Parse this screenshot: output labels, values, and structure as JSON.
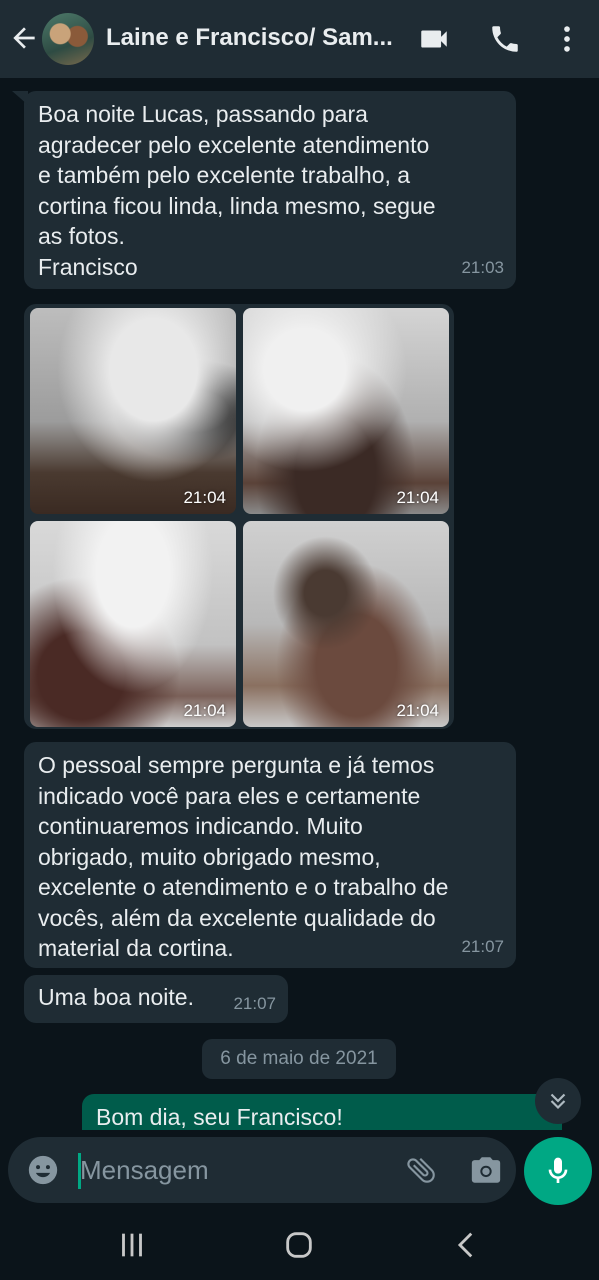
{
  "header": {
    "title": "Laine e Francisco/ Sam...",
    "icons": [
      "back-arrow-icon",
      "avatar",
      "video-call-icon",
      "voice-call-icon",
      "more-options-icon"
    ]
  },
  "messages": [
    {
      "direction": "incoming",
      "text": "Boa noite Lucas, passando para\nagradecer pelo excelente atendimento\ne também pelo excelente trabalho, a\ncortina ficou linda, linda mesmo, segue\nas fotos.\nFrancisco",
      "time": "21:03"
    },
    {
      "direction": "incoming",
      "type": "photos",
      "photos": [
        {
          "time": "21:04"
        },
        {
          "time": "21:04"
        },
        {
          "time": "21:04"
        },
        {
          "time": "21:04"
        }
      ]
    },
    {
      "direction": "incoming",
      "text": "O pessoal sempre pergunta e já temos\nindicado você para eles e certamente\ncontinuaremos indicando. Muito\nobrigado, muito obrigado mesmo,\nexcelente o atendimento e o trabalho de\nvocês, além da excelente qualidade do\nmaterial da cortina.",
      "time": "21:07"
    },
    {
      "direction": "incoming",
      "text": "Uma boa noite.",
      "time": "21:07"
    },
    {
      "direction": "outgoing",
      "text": "Bom dia, seu Francisco!"
    }
  ],
  "date_separator": "6 de maio de 2021",
  "composer": {
    "placeholder": "Mensagem"
  },
  "colors": {
    "header_bg": "#1f2c34",
    "chat_bg": "#0b141a",
    "incoming_bubble": "#1f2c34",
    "outgoing_bubble": "#005c4b",
    "accent": "#00a884",
    "meta_text": "#8696a0"
  }
}
